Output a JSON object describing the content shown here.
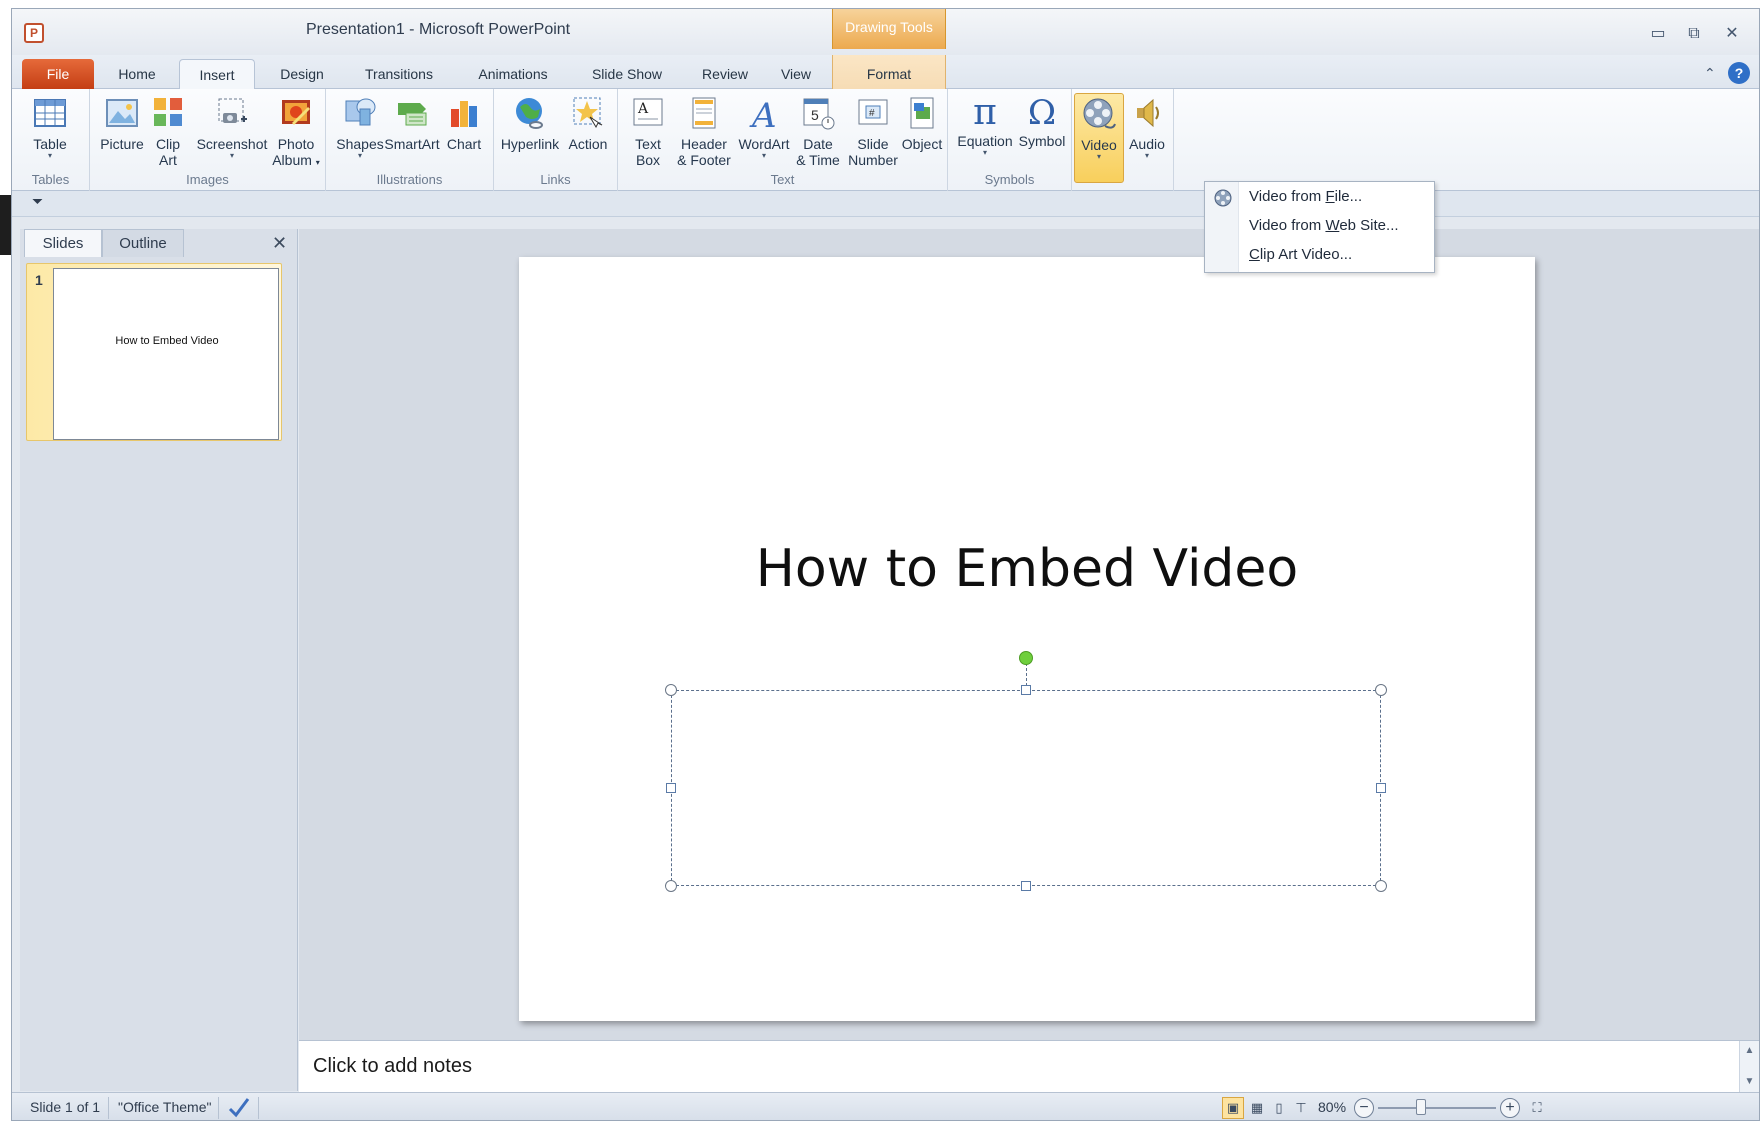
{
  "window": {
    "title": "Presentation1  -  Microsoft PowerPoint",
    "contextual_tab": "Drawing Tools",
    "app_icon": "P",
    "controls": {
      "minimize": "▭",
      "restore": "⧉",
      "close": "✕"
    }
  },
  "tabs": {
    "file": "File",
    "home": "Home",
    "insert": "Insert",
    "design": "Design",
    "transitions": "Transitions",
    "animations": "Animations",
    "slide_show": "Slide Show",
    "review": "Review",
    "view": "View",
    "format": "Format",
    "help": "?"
  },
  "ribbon": {
    "groups": {
      "tables": "Tables",
      "images": "Images",
      "illustrations": "Illustrations",
      "links": "Links",
      "text": "Text",
      "symbols": "Symbols"
    },
    "buttons": {
      "table": "Table",
      "picture": "Picture",
      "clip_art_1": "Clip",
      "clip_art_2": "Art",
      "screenshot": "Screenshot",
      "photo_album_1": "Photo",
      "photo_album_2": "Album",
      "shapes": "Shapes",
      "smartart": "SmartArt",
      "chart": "Chart",
      "hyperlink": "Hyperlink",
      "action": "Action",
      "text_box_1": "Text",
      "text_box_2": "Box",
      "header_footer_1": "Header",
      "header_footer_2": "& Footer",
      "wordart": "WordArt",
      "date_time_1": "Date",
      "date_time_2": "& Time",
      "slide_number_1": "Slide",
      "slide_number_2": "Number",
      "object": "Object",
      "equation": "Equation",
      "symbol": "Symbol",
      "video": "Video",
      "audio": "Audio"
    },
    "dropdown_arrow": "▾"
  },
  "video_menu": {
    "items": [
      {
        "before": "Video from ",
        "accel": "F",
        "after": "ile..."
      },
      {
        "before": "Video from ",
        "accel": "W",
        "after": "eb Site..."
      },
      {
        "before": "",
        "accel": "C",
        "after": "lip Art Video..."
      }
    ]
  },
  "slides_panel": {
    "tab_slides": "Slides",
    "tab_outline": "Outline",
    "close": "✕",
    "thumbnail_number": "1",
    "thumbnail_title": "How to Embed Video"
  },
  "slide": {
    "title": "How to Embed Video"
  },
  "notes": {
    "placeholder": "Click to add notes"
  },
  "status_bar": {
    "slide_info": "Slide 1 of 1",
    "theme": "\"Office Theme\"",
    "zoom": "80%",
    "zoom_out": "−",
    "zoom_in": "+"
  },
  "colors": {
    "file_tab": "#d24a1e",
    "contextual_tab": "#eca94e",
    "active_button": "#f8cf5c",
    "rotation_handle": "#6fcf3d"
  }
}
